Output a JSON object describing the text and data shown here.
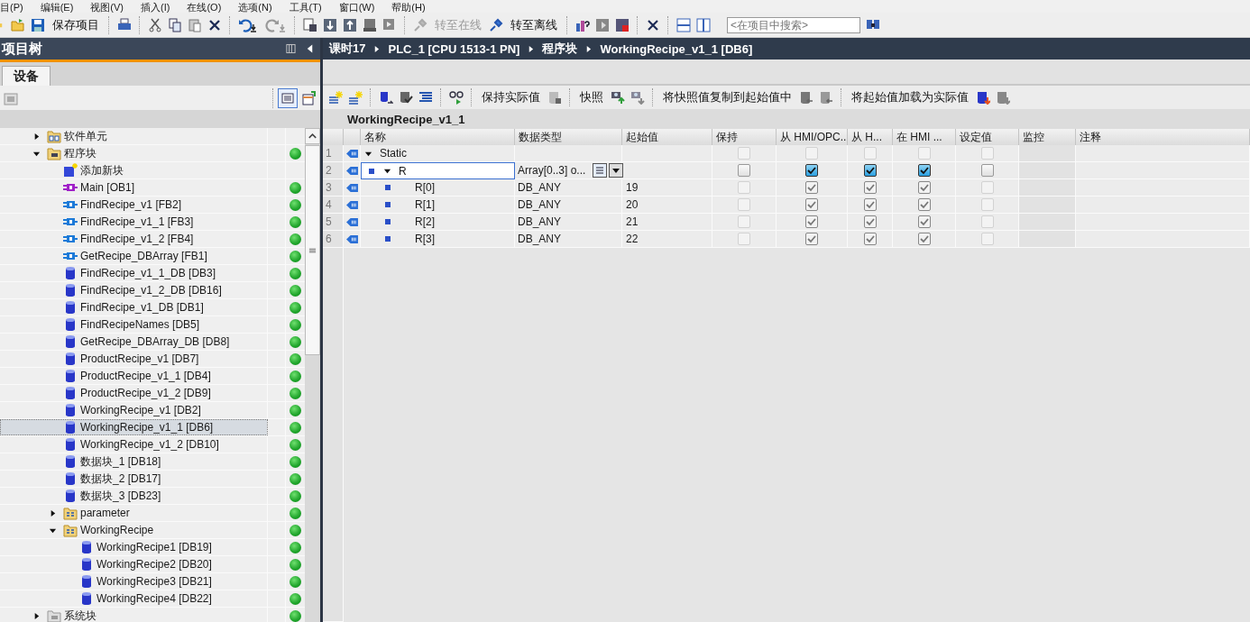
{
  "menu": [
    "目(P)",
    "编辑(E)",
    "视图(V)",
    "插入(I)",
    "在线(O)",
    "选项(N)",
    "工具(T)",
    "窗口(W)",
    "帮助(H)"
  ],
  "toolbar": {
    "buttons": [
      {
        "label": "保存项目",
        "disabled": false
      },
      {
        "label": "转至在线",
        "disabled": true
      },
      {
        "label": "转至离线",
        "disabled": false
      }
    ],
    "search": {
      "placeholder": "<在项目中搜索>"
    }
  },
  "project_tree": {
    "title": "项目树",
    "tabs": [
      {
        "label": "设备",
        "selected": true
      }
    ],
    "items": [
      {
        "label": "软件单元",
        "kind": "unit-folder",
        "expanded": false,
        "selected": false,
        "consistent": false
      },
      {
        "label": "程序块",
        "kind": "block-folder",
        "expanded": true,
        "selected": false,
        "consistent": true,
        "children": [
          {
            "label": "添加新块",
            "kind": "add",
            "selected": false,
            "consistent": false
          },
          {
            "label": "Main [OB1]",
            "kind": "ob",
            "selected": false,
            "consistent": true
          },
          {
            "label": "FindRecipe_v1 [FB2]",
            "kind": "fb",
            "selected": false,
            "consistent": true
          },
          {
            "label": "FindRecipe_v1_1 [FB3]",
            "kind": "fb",
            "selected": false,
            "consistent": true
          },
          {
            "label": "FindRecipe_v1_2 [FB4]",
            "kind": "fb",
            "selected": false,
            "consistent": true
          },
          {
            "label": "GetRecipe_DBArray [FB1]",
            "kind": "fb",
            "selected": false,
            "consistent": true
          },
          {
            "label": "FindRecipe_v1_1_DB [DB3]",
            "kind": "db",
            "selected": false,
            "consistent": true
          },
          {
            "label": "FindRecipe_v1_2_DB [DB16]",
            "kind": "db",
            "selected": false,
            "consistent": true
          },
          {
            "label": "FindRecipe_v1_DB [DB1]",
            "kind": "db",
            "selected": false,
            "consistent": true
          },
          {
            "label": "FindRecipeNames [DB5]",
            "kind": "db",
            "selected": false,
            "consistent": true
          },
          {
            "label": "GetRecipe_DBArray_DB [DB8]",
            "kind": "db",
            "selected": false,
            "consistent": true
          },
          {
            "label": "ProductRecipe_v1 [DB7]",
            "kind": "db",
            "selected": false,
            "consistent": true
          },
          {
            "label": "ProductRecipe_v1_1 [DB4]",
            "kind": "db",
            "selected": false,
            "consistent": true
          },
          {
            "label": "ProductRecipe_v1_2 [DB9]",
            "kind": "db",
            "selected": false,
            "consistent": true
          },
          {
            "label": "WorkingRecipe_v1 [DB2]",
            "kind": "db",
            "selected": false,
            "consistent": true
          },
          {
            "label": "WorkingRecipe_v1_1 [DB6]",
            "kind": "db",
            "selected": true,
            "consistent": true
          },
          {
            "label": "WorkingRecipe_v1_2 [DB10]",
            "kind": "db",
            "selected": false,
            "consistent": true
          },
          {
            "label": "数据块_1 [DB18]",
            "kind": "db",
            "selected": false,
            "consistent": true
          },
          {
            "label": "数据块_2 [DB17]",
            "kind": "db",
            "selected": false,
            "consistent": true
          },
          {
            "label": "数据块_3 [DB23]",
            "kind": "db",
            "selected": false,
            "consistent": true
          },
          {
            "label": "parameter",
            "kind": "group",
            "expanded": false,
            "selected": false,
            "consistent": true
          },
          {
            "label": "WorkingRecipe",
            "kind": "group",
            "expanded": true,
            "selected": false,
            "consistent": true,
            "children": [
              {
                "label": "WorkingRecipe1 [DB19]",
                "kind": "db",
                "selected": false,
                "consistent": true
              },
              {
                "label": "WorkingRecipe2 [DB20]",
                "kind": "db",
                "selected": false,
                "consistent": true
              },
              {
                "label": "WorkingRecipe3 [DB21]",
                "kind": "db",
                "selected": false,
                "consistent": true
              },
              {
                "label": "WorkingRecipe4 [DB22]",
                "kind": "db",
                "selected": false,
                "consistent": true
              }
            ]
          }
        ]
      },
      {
        "label": "系统块",
        "kind": "system-folder",
        "expanded": false,
        "selected": false,
        "consistent": true
      }
    ]
  },
  "editor": {
    "breadcrumb": [
      "课时17",
      "PLC_1 [CPU 1513-1 PN]",
      "程序块",
      "WorkingRecipe_v1_1 [DB6]"
    ],
    "toolbar": [
      "保持实际值",
      "快照",
      "将快照值复制到起始值中",
      "将起始值加载为实际值"
    ],
    "block_title": "WorkingRecipe_v1_1",
    "columns": [
      "名称",
      "数据类型",
      "起始值",
      "保持",
      "从 HMI/OPC..",
      "从 H...",
      "在 HMI ...",
      "设定值",
      "监控",
      "注释"
    ],
    "rows": [
      {
        "number": "1",
        "name": "Static",
        "expanded": true,
        "selected": false,
        "retain": {
          "checked": false,
          "disabled": true
        },
        "hmi_opc": {
          "checked": false,
          "disabled": true
        },
        "hmi_from": {
          "checked": false,
          "disabled": true
        },
        "hmi_visible": {
          "checked": false,
          "disabled": true
        },
        "setpoint": {
          "checked": false,
          "disabled": true
        },
        "children": [
          {
            "number": "2",
            "name": "R",
            "expanded": true,
            "selected": true,
            "data_type": "Array[0..3] o...",
            "retain": {
              "checked": false,
              "disabled": false
            },
            "hmi_opc": {
              "checked": true,
              "disabled": false
            },
            "hmi_from": {
              "checked": true,
              "disabled": false
            },
            "hmi_visible": {
              "checked": true,
              "disabled": false
            },
            "setpoint": {
              "checked": false,
              "disabled": false
            },
            "children": [
              {
                "number": "3",
                "name": "R[0]",
                "selected": false,
                "data_type": "DB_ANY",
                "start_value": "19",
                "retain": {
                  "checked": false,
                  "disabled": true
                },
                "hmi_opc": {
                  "checked": true,
                  "disabled": true
                },
                "hmi_from": {
                  "checked": true,
                  "disabled": true
                },
                "hmi_visible": {
                  "checked": true,
                  "disabled": true
                },
                "setpoint": {
                  "checked": false,
                  "disabled": true
                }
              },
              {
                "number": "4",
                "name": "R[1]",
                "selected": false,
                "data_type": "DB_ANY",
                "start_value": "20",
                "retain": {
                  "checked": false,
                  "disabled": true
                },
                "hmi_opc": {
                  "checked": true,
                  "disabled": true
                },
                "hmi_from": {
                  "checked": true,
                  "disabled": true
                },
                "hmi_visible": {
                  "checked": true,
                  "disabled": true
                },
                "setpoint": {
                  "checked": false,
                  "disabled": true
                }
              },
              {
                "number": "5",
                "name": "R[2]",
                "selected": false,
                "data_type": "DB_ANY",
                "start_value": "21",
                "retain": {
                  "checked": false,
                  "disabled": true
                },
                "hmi_opc": {
                  "checked": true,
                  "disabled": true
                },
                "hmi_from": {
                  "checked": true,
                  "disabled": true
                },
                "hmi_visible": {
                  "checked": true,
                  "disabled": true
                },
                "setpoint": {
                  "checked": false,
                  "disabled": true
                }
              },
              {
                "number": "6",
                "name": "R[3]",
                "selected": false,
                "data_type": "DB_ANY",
                "start_value": "22",
                "retain": {
                  "checked": false,
                  "disabled": true
                },
                "hmi_opc": {
                  "checked": true,
                  "disabled": true
                },
                "hmi_from": {
                  "checked": true,
                  "disabled": true
                },
                "hmi_visible": {
                  "checked": true,
                  "disabled": true
                },
                "setpoint": {
                  "checked": false,
                  "disabled": true
                }
              }
            ]
          }
        ]
      }
    ]
  }
}
